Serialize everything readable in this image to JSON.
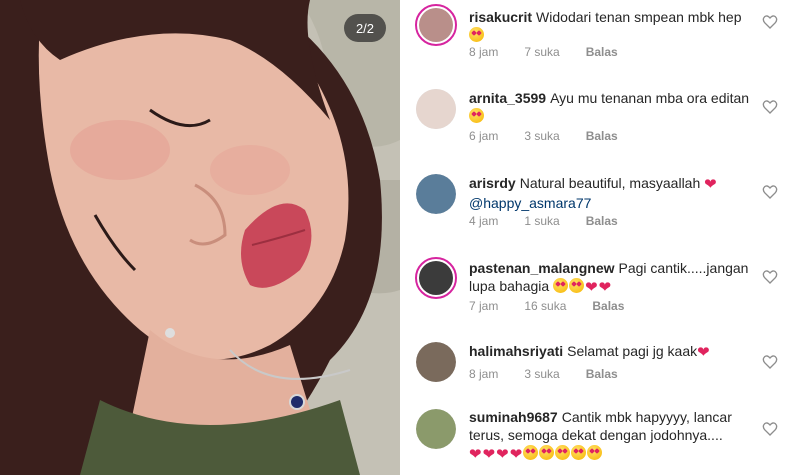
{
  "photo": {
    "counter": "2/2",
    "alt": "selfie photo"
  },
  "comments": [
    {
      "username": "risakucrit",
      "text": "Widodari tenan smpean mbk hep",
      "emojis": "smile",
      "time": "8 jam",
      "likes": "7 suka",
      "reply": "Balas",
      "story_ring": true,
      "avatar_color": "#b98f8a"
    },
    {
      "username": "arnita_3599",
      "text": "Ayu mu tenanan mba ora editan",
      "emojis": "smile",
      "time": "6 jam",
      "likes": "3 suka",
      "reply": "Balas",
      "story_ring": false,
      "avatar_color": "#e6d6cf"
    },
    {
      "username": "arisrdy",
      "text": "Natural beautiful, masyaallah",
      "mention": "@happy_asmara77",
      "emojis": "heart",
      "time": "4 jam",
      "likes": "1 suka",
      "reply": "Balas",
      "story_ring": false,
      "avatar_color": "#5a7d9a"
    },
    {
      "username": "pastenan_malangnew",
      "text": "Pagi cantik.....jangan lupa bahagia",
      "emojis": "smile smile heart heart",
      "time": "7 jam",
      "likes": "16 suka",
      "reply": "Balas",
      "story_ring": true,
      "avatar_color": "#3b3b3b"
    },
    {
      "username": "halimahsriyati",
      "text": "Selamat pagi jg kaak",
      "emojis": "heart",
      "time": "8 jam",
      "likes": "3 suka",
      "reply": "Balas",
      "story_ring": false,
      "avatar_color": "#7a6a5c"
    },
    {
      "username": "suminah9687",
      "text": "Cantik mbk hapyyyy, lancar terus, semoga dekat  dengan jodohnya....",
      "emojis": "heart heart heart heart smile smile smile smile smile",
      "time": "",
      "likes": "",
      "reply": "",
      "story_ring": false,
      "avatar_color": "#8b9a6b"
    }
  ],
  "colors": {
    "accent_ring": "#d6249f",
    "muted_text": "#8e8e8e",
    "mention": "#00376b",
    "heart_emoji": "#e0245e"
  },
  "icons": {
    "like": "heart-outline-icon"
  }
}
